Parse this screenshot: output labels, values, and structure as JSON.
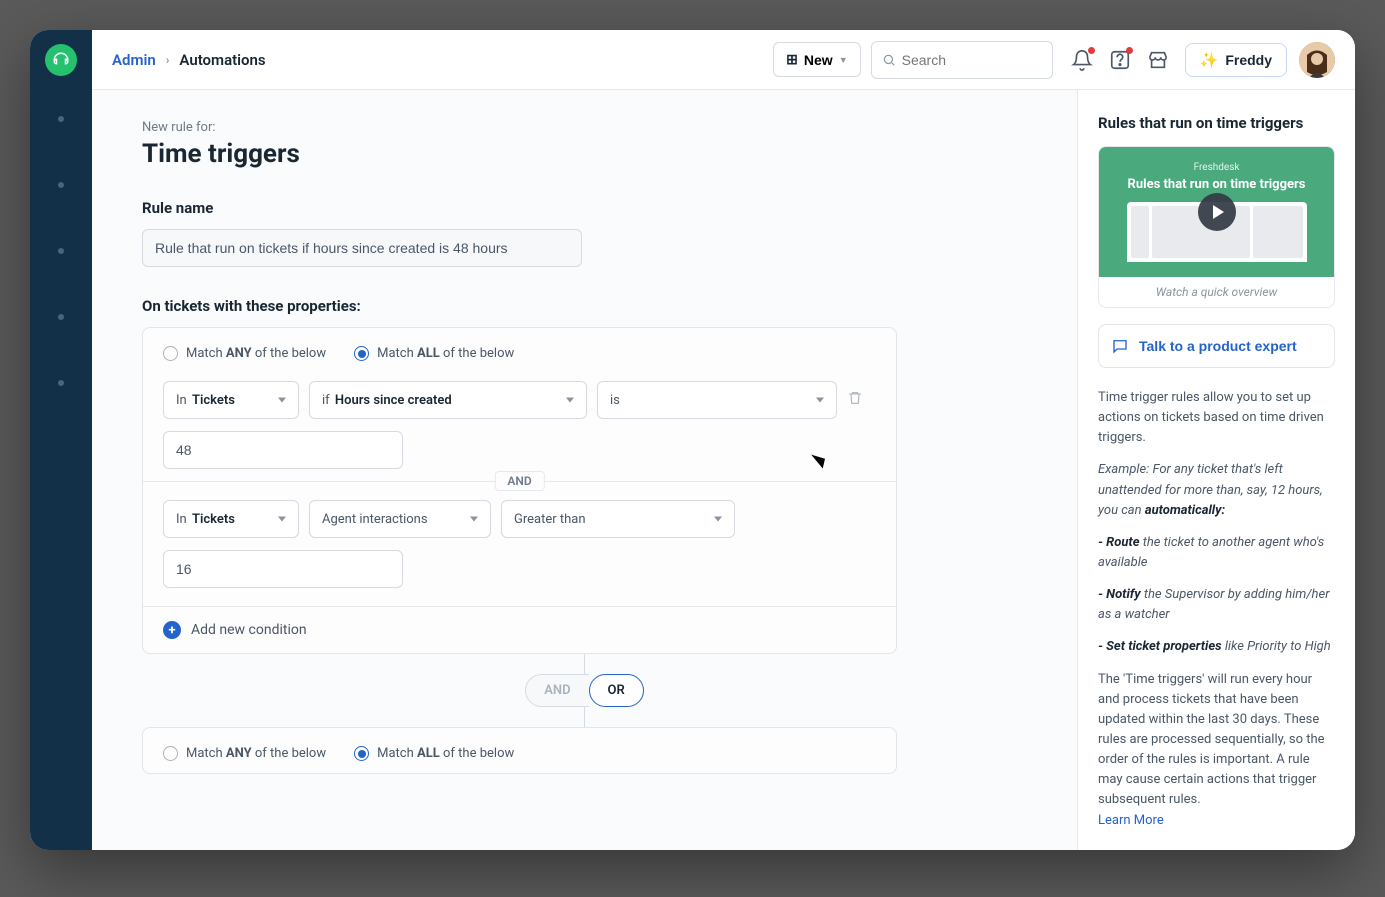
{
  "breadcrumb": {
    "root": "Admin",
    "current": "Automations"
  },
  "topbar": {
    "new_label": "New",
    "search_placeholder": "Search",
    "freddy_label": "Freddy"
  },
  "page": {
    "pre_title": "New rule for:",
    "title": "Time triggers",
    "rule_name_label": "Rule name",
    "rule_name_value": "Rule that run on tickets if hours since created is 48 hours",
    "conditions_label": "On tickets with these properties:"
  },
  "match": {
    "any_prefix": "Match ",
    "any_bold": "ANY",
    "any_suffix": " of the below",
    "all_prefix": "Match ",
    "all_bold": "ALL",
    "all_suffix": " of the below"
  },
  "condition1": {
    "scope_prefix": "In ",
    "scope_bold": "Tickets",
    "field_prefix": "if ",
    "field_bold": "Hours since created",
    "operator": "is",
    "value": "48"
  },
  "joiner": {
    "and": "AND"
  },
  "condition2": {
    "scope_prefix": "In ",
    "scope_bold": "Tickets",
    "field": "Agent interactions",
    "operator": "Greater than",
    "value": "16"
  },
  "add_condition": "Add new condition",
  "connector": {
    "and": "AND",
    "or": "OR"
  },
  "side": {
    "heading": "Rules that run on time triggers",
    "vendor": "Freshdesk",
    "thumb_title": "Rules that run on time triggers",
    "caption": "Watch a quick overview",
    "expert": "Talk to a product expert",
    "intro": "Time trigger rules allow you to set up actions on tickets based on time driven triggers.",
    "example_prefix": "Example: For any ticket that's left unattended for more than, say, 12 hours, you can ",
    "example_bold": "automatically:",
    "bullet1_bold": "- Route",
    "bullet1_rest": " the ticket to another agent who's available",
    "bullet2_bold": "- Notify",
    "bullet2_rest": " the Supervisor by adding him/her as a watcher",
    "bullet3_bold": "- Set ticket properties",
    "bullet3_rest": " like Priority to High",
    "explain": "The 'Time triggers' will run every hour and process tickets that have been updated within the last 30 days. These rules are processed sequentially, so the order of the rules is important. A rule may cause certain actions that trigger subsequent rules.",
    "learn_more": "Learn More"
  }
}
